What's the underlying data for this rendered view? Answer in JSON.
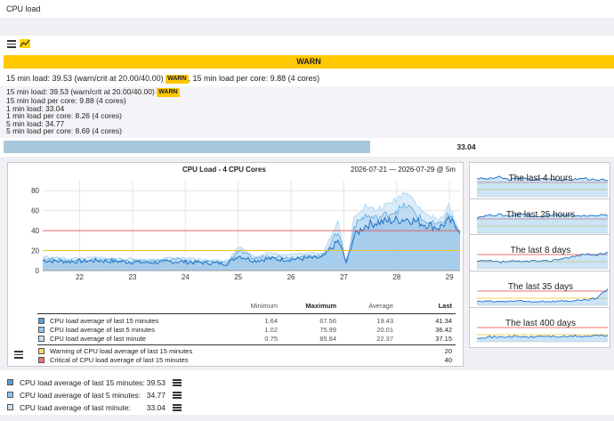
{
  "page": {
    "title": "CPU load"
  },
  "state": {
    "label": "WARN",
    "color": "#ffc800"
  },
  "summary": {
    "prefix": "15 min load: 39.53 (warn/crit at 20.00/40.00)",
    "badge": "WARN",
    "suffix": ", 15 min load per core: 9.88 (4 cores)"
  },
  "details": {
    "line1": "15 min load: 39.53 (warn/crit at 20.00/40.00)",
    "line1_badge": "WARN",
    "lines": [
      "15 min load per core: 9.88 (4 cores)",
      "1 min load: 33.04",
      "1 min load per core: 8.26 (4 cores)",
      "5 min load: 34.77",
      "5 min load per core: 8.69 (4 cores)"
    ]
  },
  "perfometer": {
    "value": "33.04",
    "fraction": 0.6,
    "color": "#a8c8dc"
  },
  "graph": {
    "title": "CPU Load - 4 CPU Cores",
    "range": "2026-07-21 — 2026-07-29 @ 5m",
    "legend_headers": {
      "minimum": "Minimum",
      "maximum": "Maximum",
      "average": "Average",
      "last": "Last"
    },
    "legend_rows": [
      {
        "name": "CPU load average of last 15 minutes",
        "min": "1.64",
        "max": "67.56",
        "avg": "19.43",
        "last": "41.34",
        "color": "#5a9fd8"
      },
      {
        "name": "CPU load average of last 5 minutes",
        "min": "1.02",
        "max": "75.99",
        "avg": "20.01",
        "last": "36.42",
        "color": "#8cc4ec"
      },
      {
        "name": "CPU load average of last minute",
        "min": "0.75",
        "max": "85.84",
        "avg": "22.37",
        "last": "37.15",
        "color": "#c4e0f4"
      }
    ],
    "threshold_rows": [
      {
        "name": "Warning of CPU load average of last 15 minutes",
        "last": "20",
        "color": "#ffd966"
      },
      {
        "name": "Critical of CPU load average of last 15 minutes",
        "last": "40",
        "color": "#f07070"
      }
    ]
  },
  "chart_data": {
    "type": "area",
    "title": "CPU Load - 4 CPU Cores",
    "xlabel": "",
    "ylabel": "",
    "x_ticks": [
      "22",
      "23",
      "24",
      "25",
      "26",
      "27",
      "28",
      "29"
    ],
    "y_ticks": [
      "0",
      "20",
      "40",
      "60",
      "80"
    ],
    "ylim": [
      0,
      90
    ],
    "xlim": [
      21.3,
      29.2
    ],
    "grid": true,
    "thresholds": {
      "warn": 20,
      "crit": 40
    },
    "series": [
      {
        "name": "CPU load average of last 15 minutes",
        "x": [
          21.3,
          21.8,
          22.3,
          22.8,
          23.3,
          23.8,
          24.3,
          24.8,
          25.0,
          25.3,
          25.6,
          25.9,
          26.2,
          26.6,
          26.9,
          27.05,
          27.2,
          27.4,
          27.6,
          27.9,
          28.2,
          28.5,
          28.8,
          29.0,
          29.2
        ],
        "values": [
          10,
          9,
          10,
          9,
          8,
          9,
          8,
          7,
          15,
          10,
          12,
          11,
          12,
          13,
          30,
          8,
          35,
          45,
          48,
          50,
          52,
          47,
          43,
          50,
          41
        ]
      },
      {
        "name": "CPU load average of last 5 minutes",
        "x": [
          21.3,
          21.8,
          22.3,
          22.8,
          23.3,
          23.8,
          24.3,
          24.8,
          25.0,
          25.3,
          25.6,
          25.9,
          26.2,
          26.6,
          26.9,
          27.05,
          27.2,
          27.4,
          27.6,
          27.9,
          28.2,
          28.5,
          28.8,
          29.0,
          29.2
        ],
        "values": [
          12,
          10,
          11,
          10,
          9,
          11,
          9,
          8,
          20,
          12,
          15,
          13,
          14,
          15,
          40,
          5,
          45,
          55,
          52,
          58,
          65,
          50,
          45,
          57,
          36
        ]
      },
      {
        "name": "CPU load average of last minute",
        "x": [
          21.3,
          21.8,
          22.3,
          22.8,
          23.3,
          23.8,
          24.3,
          24.8,
          25.0,
          25.3,
          25.6,
          25.9,
          26.2,
          26.6,
          26.9,
          27.05,
          27.2,
          27.4,
          27.6,
          27.9,
          28.2,
          28.5,
          28.8,
          29.0,
          29.2
        ],
        "values": [
          14,
          12,
          13,
          12,
          11,
          13,
          11,
          10,
          25,
          14,
          18,
          16,
          17,
          18,
          50,
          3,
          55,
          65,
          60,
          68,
          80,
          58,
          50,
          65,
          37
        ]
      }
    ]
  },
  "thumbnails": [
    {
      "label": "The last 4 hours"
    },
    {
      "label": "The last 25 hours"
    },
    {
      "label": "The last 8 days"
    },
    {
      "label": "The last 35 days"
    },
    {
      "label": "The last 400 days"
    }
  ],
  "bottom_rows": [
    {
      "label": "CPU load average of last 15 minutes:",
      "value": "39.53",
      "color": "#5a9fd8"
    },
    {
      "label": "CPU load average of last 5 minutes:",
      "value": "34.77",
      "color": "#8cc4ec"
    },
    {
      "label": "CPU load average of last minute:",
      "value": "33.04",
      "color": "#c4e0f4"
    }
  ],
  "icons": {
    "menu": "menu-icon",
    "graph": "graph-icon"
  }
}
